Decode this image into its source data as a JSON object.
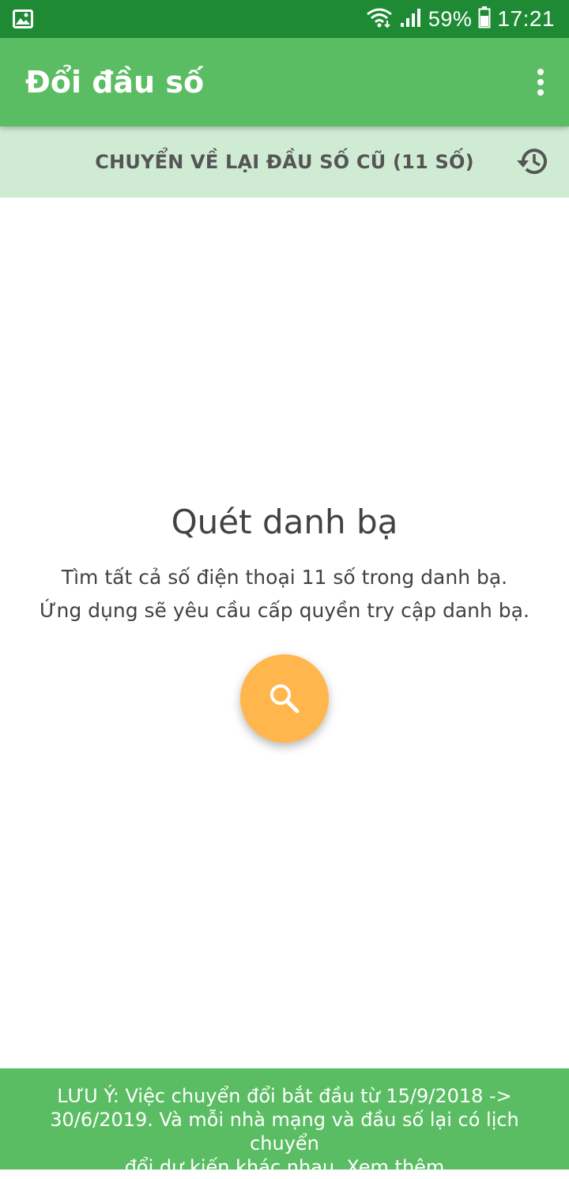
{
  "status_bar": {
    "battery_percent": "59%",
    "time": "17:21",
    "icons": [
      "gallery-icon",
      "wifi-icon",
      "signal-icon",
      "battery-icon"
    ]
  },
  "app_bar": {
    "title": "Đổi đầu số",
    "menu_icon": "more-vert-icon"
  },
  "revert_bar": {
    "label": "CHUYỂN VỀ LẠI ĐẦU SỐ CŨ (11 SỐ)",
    "icon": "history-icon"
  },
  "main": {
    "title": "Quét danh bạ",
    "description_lines": [
      "Tìm tất cả số điện thoại 11 số trong danh bạ.",
      "Ứng dụng sẽ yêu cầu cấp quyền try cập danh bạ."
    ],
    "scan_button_icon": "search-icon"
  },
  "notice": {
    "text_line1": "LƯU Ý: Việc chuyển đổi bắt đầu từ 15/9/2018 ->",
    "text_line2": "30/6/2019. Và mỗi nhà mạng và đầu số lại có lịch chuyển",
    "text_line3": "đổi dự kiến khác nhau.",
    "link": "Xem thêm"
  },
  "colors": {
    "status_bar": "#1e8a34",
    "primary": "#5bbd63",
    "revert_bar": "#d0ebd3",
    "fab": "#ffb74d",
    "text": "#424242"
  }
}
